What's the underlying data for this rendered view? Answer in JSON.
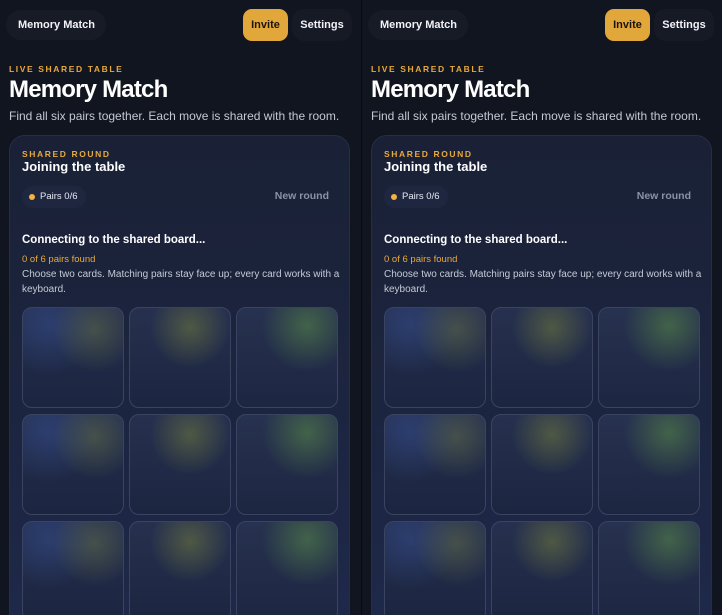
{
  "panes": [
    {
      "app_name": "Memory Match",
      "invite_label": "Invite",
      "settings_label": "Settings",
      "eyebrow": "LIVE SHARED TABLE",
      "title": "Memory Match",
      "subtitle": "Find all six pairs together. Each move is shared with the room.",
      "round": {
        "eyebrow": "SHARED ROUND",
        "title": "Joining the table",
        "pairs_badge": "Pairs 0/6",
        "new_round_label": "New round",
        "status": "Connecting to the shared board...",
        "found": "0 of 6 pairs found",
        "help": "Choose two cards. Matching pairs stay face up; every card works with a keyboard."
      }
    },
    {
      "app_name": "Memory Match",
      "invite_label": "Invite",
      "settings_label": "Settings",
      "eyebrow": "LIVE SHARED TABLE",
      "title": "Memory Match",
      "subtitle": "Find all six pairs together. Each move is shared with the room.",
      "round": {
        "eyebrow": "SHARED ROUND",
        "title": "Joining the table",
        "pairs_badge": "Pairs 0/6",
        "new_round_label": "New round",
        "status": "Connecting to the shared board...",
        "found": "0 of 6 pairs found",
        "help": "Choose two cards. Matching pairs stay face up; every card works with a keyboard."
      }
    }
  ],
  "colors": {
    "accent": "#e2a73a",
    "background": "#111520",
    "card": "#1c2540"
  }
}
